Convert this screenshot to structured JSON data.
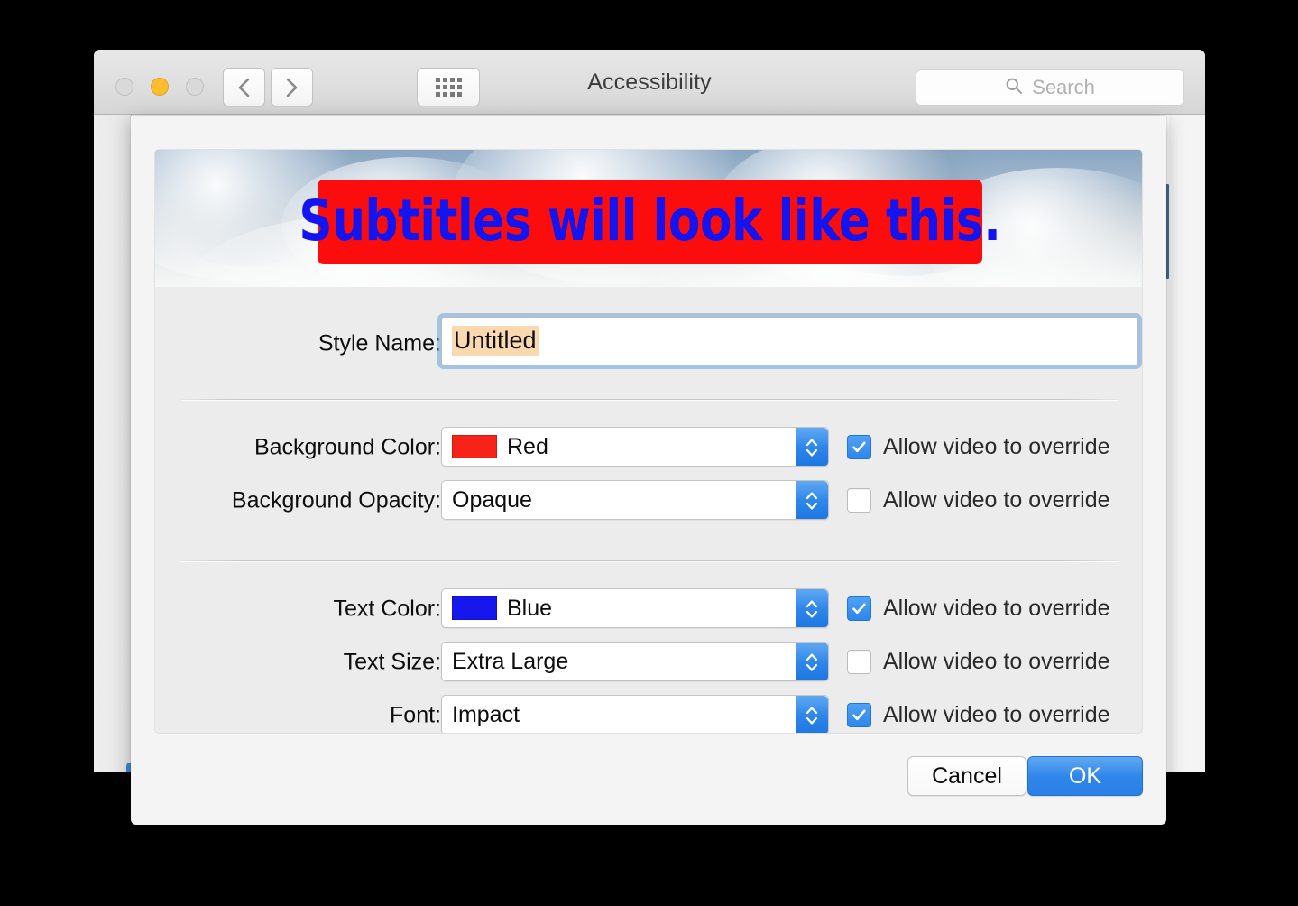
{
  "window": {
    "title": "Accessibility",
    "traffic_lights": [
      {
        "name": "close",
        "color": "#d9d9d9",
        "active": false
      },
      {
        "name": "minimize",
        "color": "#fbbd2e",
        "active": true
      },
      {
        "name": "zoom",
        "color": "#d9d9d9",
        "active": false
      }
    ],
    "toolbar": {
      "back_icon": "chevron-left-icon",
      "forward_icon": "chevron-right-icon",
      "show_all_icon": "grid-icon"
    },
    "search": {
      "icon": "search-icon",
      "placeholder": "Search",
      "value": ""
    }
  },
  "sheet": {
    "preview": {
      "subtitle_text": "Subtitles will look like this.",
      "text_color": "#1414f0",
      "background_color": "#fb0d0d",
      "scene_description": "cloudy-sky"
    },
    "style_name": {
      "label": "Style Name:",
      "value": "Untitled",
      "selected": true,
      "focused": true
    },
    "fields": [
      {
        "label": "Background Color:",
        "value": "Red",
        "swatch": "#f72218",
        "has_swatch": true,
        "override_label": "Allow video to override",
        "override_checked": true
      },
      {
        "label": "Background Opacity:",
        "value": "Opaque",
        "swatch": "",
        "has_swatch": false,
        "override_label": "Allow video to override",
        "override_checked": false
      },
      {
        "label": "Text Color:",
        "value": "Blue",
        "swatch": "#1616ef",
        "has_swatch": true,
        "override_label": "Allow video to override",
        "override_checked": true
      },
      {
        "label": "Text Size:",
        "value": "Extra Large",
        "swatch": "",
        "has_swatch": false,
        "override_label": "Allow video to override",
        "override_checked": false
      },
      {
        "label": "Font:",
        "value": "Impact",
        "swatch": "",
        "has_swatch": false,
        "override_label": "Allow video to override",
        "override_checked": true
      }
    ],
    "buttons": {
      "cancel": "Cancel",
      "ok": "OK"
    }
  },
  "colors": {
    "accent": "#2f86ea",
    "selection_highlight": "#fbd9b0",
    "sheet_bg": "#f4f4f4",
    "panel_bg": "#ececec"
  }
}
